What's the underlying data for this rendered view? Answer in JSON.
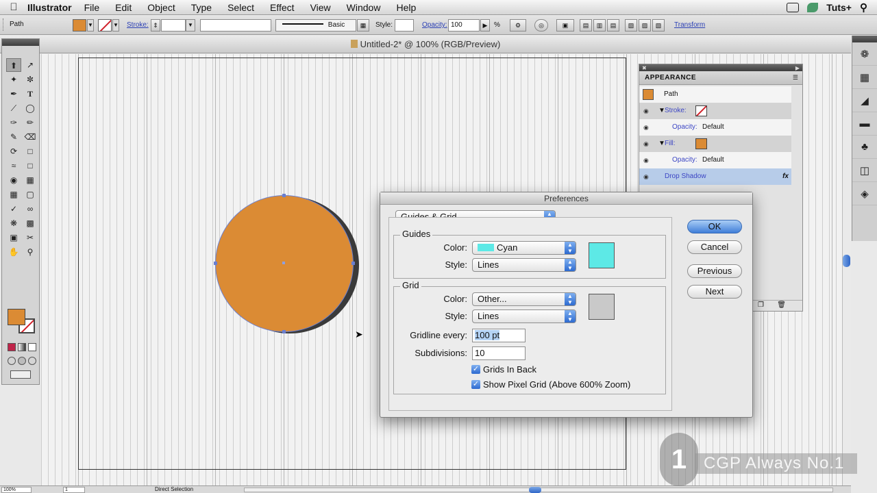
{
  "menubar": {
    "app_name": "Illustrator",
    "items": [
      "File",
      "Edit",
      "Object",
      "Type",
      "Select",
      "Effect",
      "View",
      "Window",
      "Help"
    ],
    "right_label": "Tuts+"
  },
  "controlbar": {
    "selection_label": "Path",
    "fill_color": "#db8b34",
    "stroke_label": "Stroke:",
    "brush_label": "Basic",
    "style_label": "Style:",
    "opacity_label": "Opacity:",
    "opacity_value": "100",
    "opacity_unit": "%",
    "transform_label": "Transform"
  },
  "document": {
    "title": "Untitled-2* @ 100% (RGB/Preview)"
  },
  "artwork": {
    "circle_fill": "#db8b34",
    "shadow_color": "#3a3a3a"
  },
  "appearance_panel": {
    "tab_label": "APPEARANCE",
    "rows": {
      "path": "Path",
      "stroke": "Stroke:",
      "stroke_opacity_label": "Opacity:",
      "stroke_opacity_value": "Default",
      "fill": "Fill:",
      "fill_opacity_label": "Opacity:",
      "fill_opacity_value": "Default",
      "effect": "Drop Shadow",
      "fx": "fx"
    }
  },
  "preferences": {
    "title": "Preferences",
    "section": "Guides & Grid",
    "guides": {
      "title": "Guides",
      "color_label": "Color:",
      "color_value": "Cyan",
      "color_hex": "#5de9e6",
      "style_label": "Style:",
      "style_value": "Lines"
    },
    "grid": {
      "title": "Grid",
      "color_label": "Color:",
      "color_value": "Other...",
      "color_hex": "#c9c9c9",
      "style_label": "Style:",
      "style_value": "Lines",
      "gridline_label": "Gridline every:",
      "gridline_value": "100 pt",
      "subdivisions_label": "Subdivisions:",
      "subdivisions_value": "10",
      "grids_in_back": "Grids In Back",
      "show_pixel_grid": "Show Pixel Grid (Above 600% Zoom)"
    },
    "buttons": {
      "ok": "OK",
      "cancel": "Cancel",
      "previous": "Previous",
      "next": "Next"
    }
  },
  "statusbar": {
    "zoom": "100%",
    "artboard": "1",
    "tool": "Direct Selection"
  },
  "watermark": {
    "number": "1",
    "text": "CGP Always No.1"
  }
}
